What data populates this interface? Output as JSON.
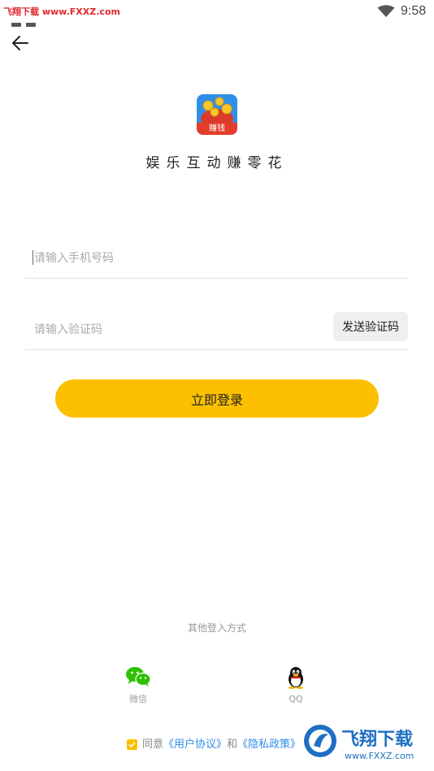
{
  "status_bar": {
    "watermark": "飞翔下载 www.FXXZ.com",
    "time": "9:58"
  },
  "app": {
    "title": "娱乐互动赚零花",
    "logo_badge": "赚钱"
  },
  "form": {
    "phone_placeholder": "请输入手机号码",
    "code_placeholder": "请输入验证码",
    "send_code_label": "发送验证码",
    "login_label": "立即登录"
  },
  "social_login": {
    "title": "其他登入方式",
    "wechat_label": "微信",
    "qq_label": "QQ"
  },
  "agreement": {
    "prefix": "同意",
    "user_agreement": "《用户协议》",
    "and": "和",
    "privacy_policy": "《隐私政策》",
    "checked": true
  },
  "watermark_bottom": {
    "brand": "飞翔下载",
    "url": "www.FXXZ.com"
  },
  "colors": {
    "accent": "#fcc000",
    "link": "#2e8ce6",
    "wechat": "#2dc100"
  }
}
